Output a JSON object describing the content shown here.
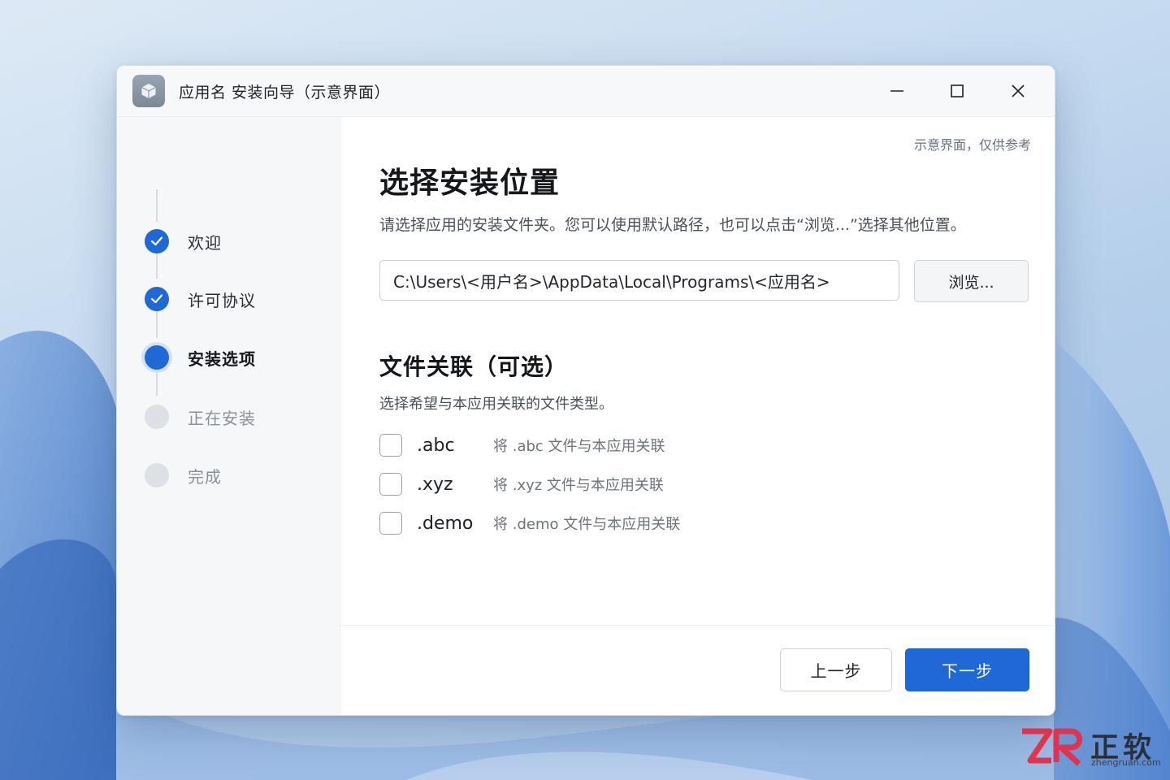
{
  "window": {
    "title": "应用名 安装向导（示意界面）",
    "controls": [
      "minimize",
      "maximize",
      "close"
    ]
  },
  "steps": [
    {
      "label": "欢迎",
      "state": "done"
    },
    {
      "label": "许可协议",
      "state": "done"
    },
    {
      "label": "安装选项",
      "state": "current"
    },
    {
      "label": "正在安装",
      "state": "todo"
    },
    {
      "label": "完成",
      "state": "todo"
    }
  ],
  "content": {
    "note": "示意界面，仅供参考",
    "heading": "选择安装位置",
    "description": "请选择应用的安装文件夹。您可以使用默认路径，也可以点击“浏览...”选择其他位置。",
    "install_path": "C:\\Users\\<用户名>\\AppData\\Local\\Programs\\<应用名>",
    "browse_label": "浏览...",
    "associations": {
      "title": "文件关联（可选）",
      "description": "选择希望与本应用关联的文件类型。",
      "items": [
        {
          "ext": ".abc",
          "desc": "将 .abc 文件与本应用关联",
          "checked": false
        },
        {
          "ext": ".xyz",
          "desc": "将 .xyz 文件与本应用关联",
          "checked": false
        },
        {
          "ext": ".demo",
          "desc": "将 .demo 文件与本应用关联",
          "checked": false
        }
      ]
    }
  },
  "footer": {
    "back_label": "上一步",
    "next_label": "下一步"
  },
  "colors": {
    "accent": "#1f68d6",
    "step_todo": "#dde1e6"
  },
  "icons": {
    "app": "package-box-icon",
    "step_done": "checkmark-icon"
  },
  "watermark": {
    "brand": "正软",
    "url": "zhengruan.com"
  }
}
